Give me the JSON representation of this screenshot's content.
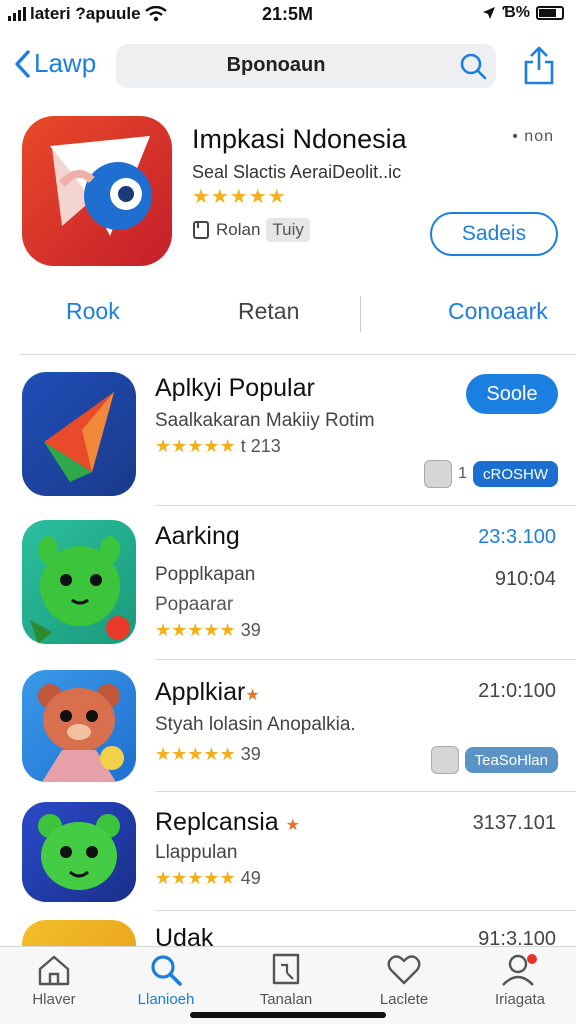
{
  "status_bar": {
    "carrier": "lateri ?apuule",
    "time": "21:5M",
    "battery": "Ɓ%"
  },
  "nav": {
    "back_label": "Lawp",
    "search_query": "Bponoaun"
  },
  "featured": {
    "title": "Impkasi Ndonesia",
    "more": "• non",
    "subtitle": "Seal Slactis AeraiDeolit..ic",
    "stars": "★★★★★",
    "meta_label": "Rolan",
    "meta_chip": "Tuiy",
    "button_label": "Sadeis"
  },
  "tabs": [
    "Rook",
    "Retan",
    "Conoaark"
  ],
  "apps": [
    {
      "name": "Aplkyi Popular",
      "subtitle": "Saalkakaran Makiiy Rotim",
      "stars": "★★★★★",
      "rating_count": "t 213",
      "button_label": "Soole",
      "tag_number": "1",
      "tag_label": "cROSHW"
    },
    {
      "name": "Aarking",
      "subtitle": "Popplkapan",
      "subtitle2": "Popaarar",
      "stars": "★★★★★",
      "rating_count": "39",
      "value": "23:3.100",
      "value2": "910:04"
    },
    {
      "name": "Applkiar",
      "subtitle": "Styah lolasin Anopalkia.",
      "stars": "★★★★★",
      "rating_count": "39",
      "value": "21:0:100",
      "tag_label": "TeaSoHlan"
    },
    {
      "name": "Replcansia",
      "subtitle": "Llappulan",
      "stars": "★★★★★",
      "rating_count": "49",
      "value": "3137.101"
    },
    {
      "name": "Udak",
      "value": "91:3.100"
    }
  ],
  "tab_bar": [
    {
      "label": "Hlaver",
      "icon": "home-icon"
    },
    {
      "label": "Llanioeh",
      "icon": "search-icon"
    },
    {
      "label": "Tanalan",
      "icon": "apps-icon"
    },
    {
      "label": "Laclete",
      "icon": "heart-icon"
    },
    {
      "label": "Iriagata",
      "icon": "profile-icon"
    }
  ],
  "colors": {
    "accent": "#1a7fe0",
    "star": "#f2b01e"
  }
}
